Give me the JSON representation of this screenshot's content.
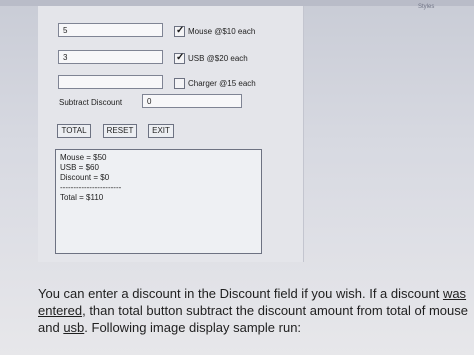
{
  "header": {
    "styles_label": "Styles"
  },
  "form": {
    "mouse_qty": "5",
    "usb_qty": "3",
    "charger_qty": "",
    "mouse_option": {
      "label": "Mouse @$10 each",
      "checked": true
    },
    "usb_option": {
      "label": "USB @$20 each",
      "checked": true
    },
    "charger_option": {
      "label": "Charger @15 each",
      "checked": false
    },
    "discount_label": "Subtract Discount",
    "discount_value": "0",
    "buttons": {
      "total": "TOTAL",
      "reset": "RESET",
      "exit": "EXIT"
    }
  },
  "output": {
    "mouse_line": "Mouse = $50",
    "usb_line": "USB = $60",
    "discount_line": "Discount = $0",
    "separator": "-----------------------",
    "total_line": "Total = $110"
  },
  "instructions": {
    "p1": "You can enter a discount in the Discount field if you wish. If a discount ",
    "p2": "was",
    "p3": "entered",
    "p4": ", than total button subtract the discount amount from total of mouse and ",
    "p5": "usb",
    "p6": ". Following image display sample run:"
  }
}
